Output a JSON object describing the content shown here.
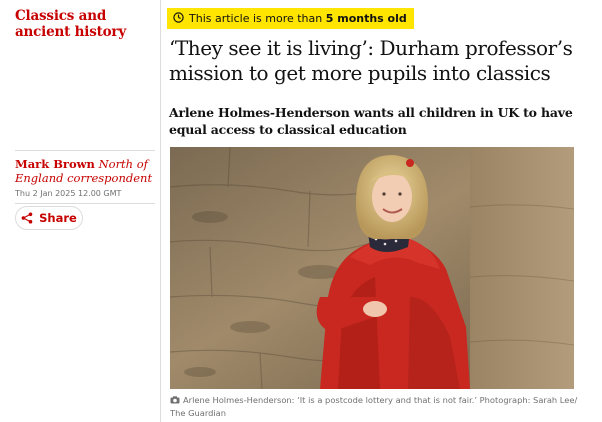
{
  "section": {
    "label": "Classics and ancient history"
  },
  "byline": {
    "author": "Mark Brown",
    "role": "North of England correspondent"
  },
  "dateline": "Thu 2 Jan 2025 12.00 GMT",
  "share": {
    "label": "Share",
    "icon": "share-icon"
  },
  "age_warning": {
    "prefix": "This article is more than ",
    "age": "5 months old",
    "icon": "clock-icon"
  },
  "headline": "‘They see it is living’: Durham professor’s mission to get more pupils into classics",
  "standfirst": "Arlene Holmes-Henderson wants all children in UK to have equal access to classical education",
  "image": {
    "caption": "Arlene Holmes-Henderson: ‘It is a postcode lottery and that is not fair.’ Photograph: Sarah Lee/ The Guardian",
    "icon": "camera-icon"
  },
  "colors": {
    "accent": "#c70000",
    "warning_bg": "#ffe500",
    "text": "#121212",
    "muted": "#707070"
  }
}
